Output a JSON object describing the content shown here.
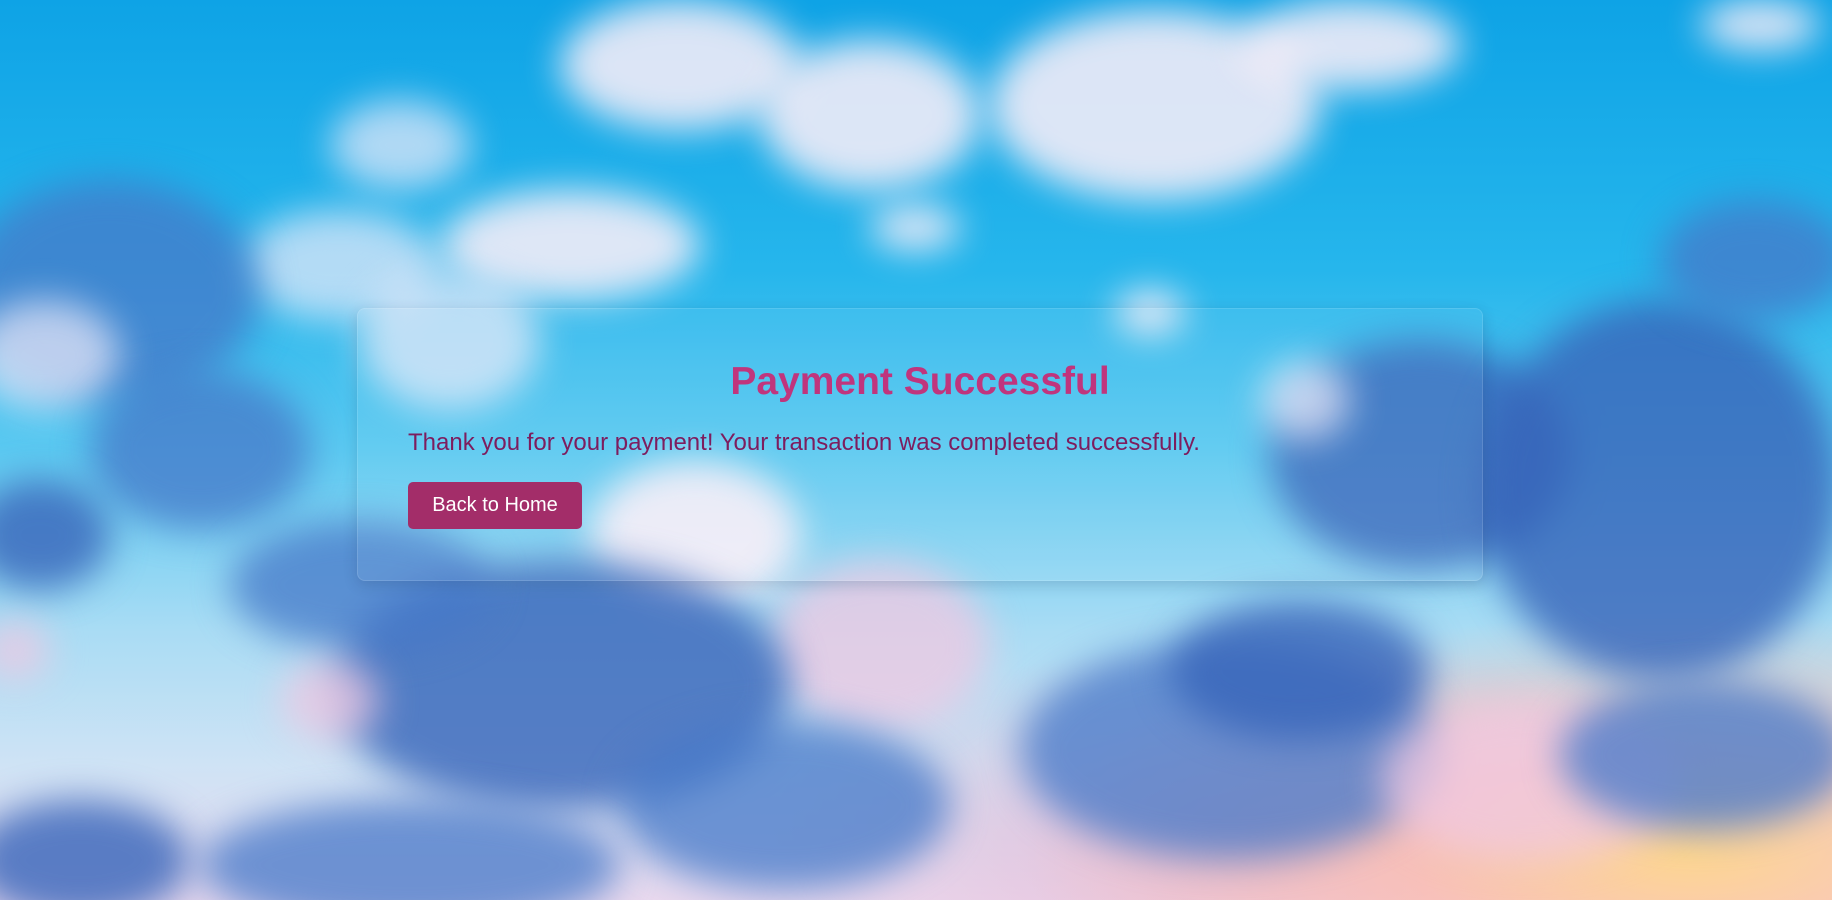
{
  "page": {
    "title": "Payment Successful",
    "message": "Thank you for your payment! Your transaction was completed successfully.",
    "back_button_label": "Back to Home"
  },
  "colors": {
    "title": "#c0357d",
    "message": "#7d1d5e",
    "button_bg": "#a32d69",
    "button_text": "#ffffff"
  }
}
